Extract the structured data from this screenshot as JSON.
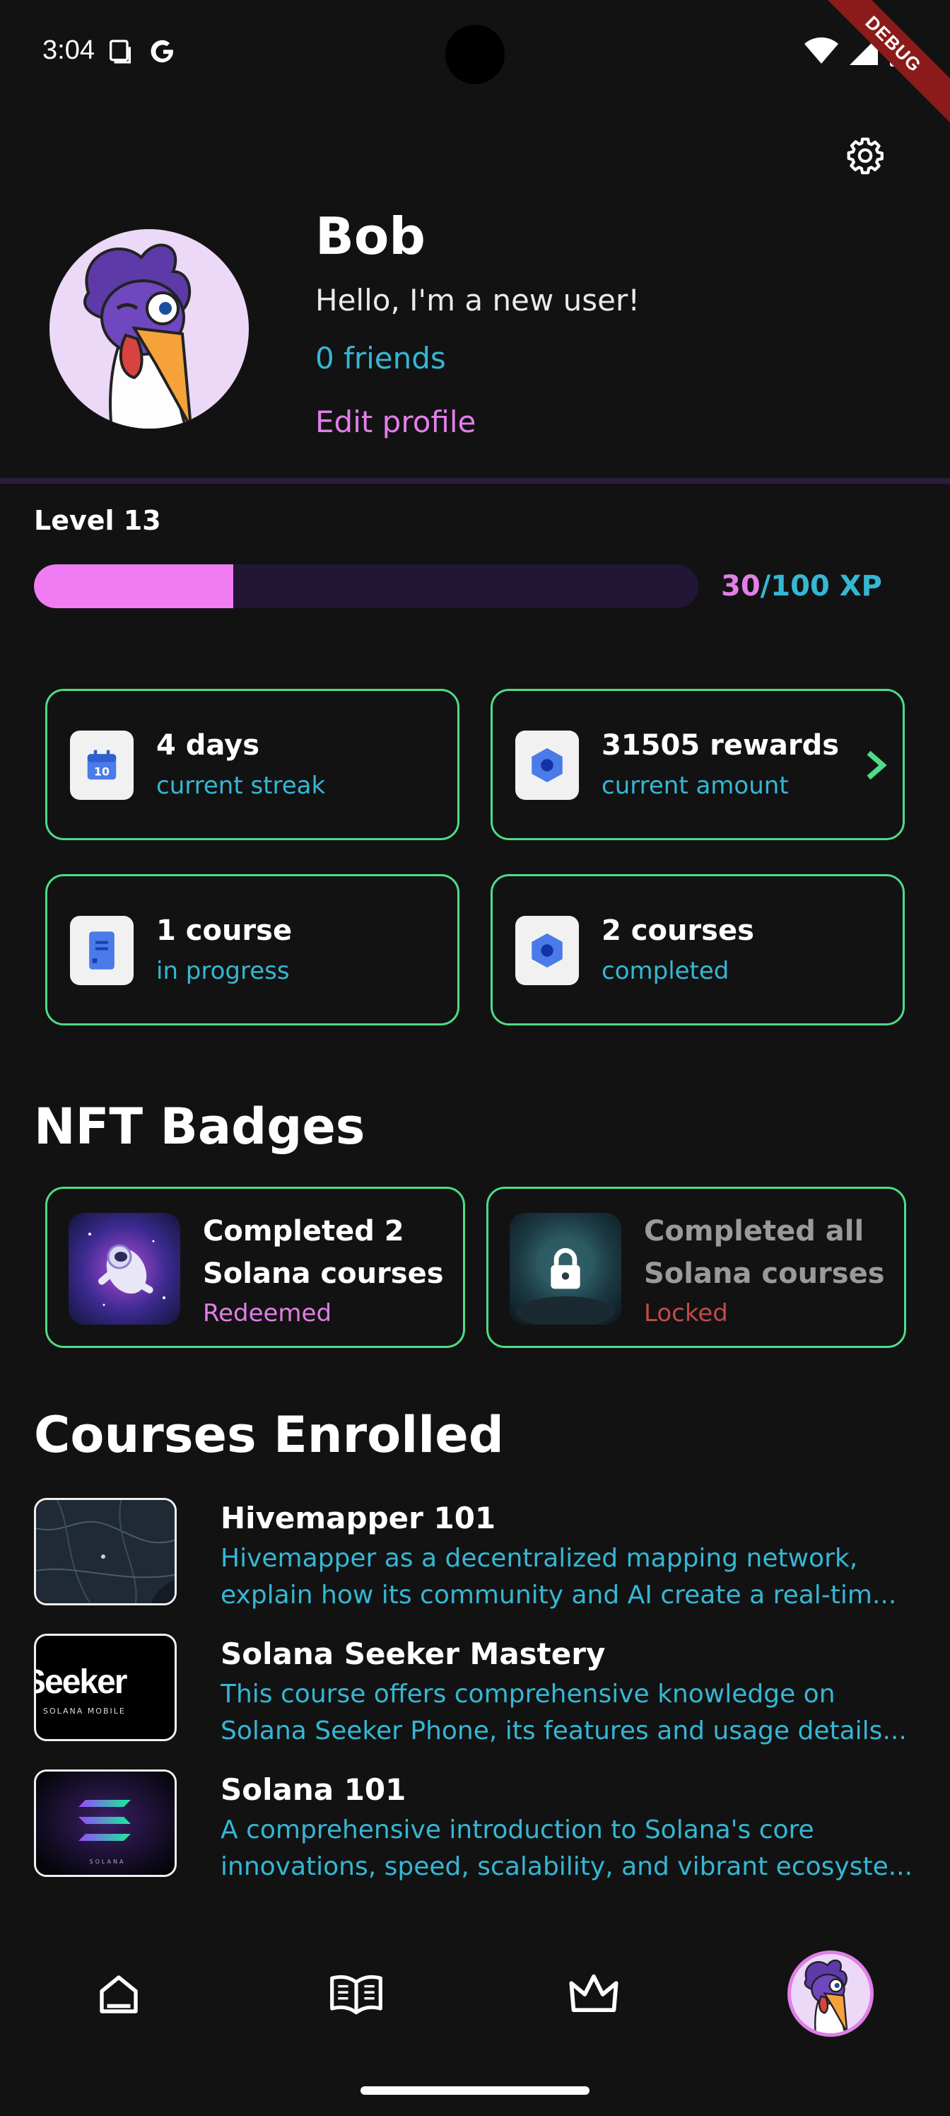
{
  "status_bar": {
    "time": "3:04",
    "ribbon": "DEBUG"
  },
  "profile": {
    "name": "Bob",
    "bio": "Hello, I'm a new user!",
    "friends": "0 friends",
    "edit_label": "Edit profile"
  },
  "level": {
    "label": "Level 13",
    "xp_current": "30",
    "xp_total": "/100 XP",
    "progress_fraction": 0.3
  },
  "stats": [
    {
      "title": "4 days",
      "sub": "current streak",
      "icon": "calendar-icon"
    },
    {
      "title": "31505 rewards",
      "sub": "current amount",
      "icon": "hexagon-icon"
    },
    {
      "title": "1 course",
      "sub": "in progress",
      "icon": "book-icon"
    },
    {
      "title": "2 courses",
      "sub": "completed",
      "icon": "hexagon-icon"
    }
  ],
  "badges_section": {
    "heading": "NFT Badges",
    "items": [
      {
        "title": "Completed 2 Solana courses",
        "status": "Redeemed",
        "status_color": "#e27ee8"
      },
      {
        "title": "Completed all Solana courses",
        "status": "Locked",
        "status_color": "#c24a4a"
      }
    ]
  },
  "courses_section": {
    "heading": "Courses Enrolled",
    "items": [
      {
        "title": "Hivemapper 101",
        "desc_line1": "Hivemapper as a decentralized mapping network,",
        "desc_line2": "explain how its community and AI create a real-tim..."
      },
      {
        "title": "Solana Seeker Mastery",
        "desc_line1": "This course offers comprehensive knowledge on",
        "desc_line2": "Solana Seeker Phone, its features and usage details...",
        "thumb_text": "Seeker",
        "thumb_subtext": "SOLANA  MOBILE"
      },
      {
        "title": "Solana 101",
        "desc_line1": "A comprehensive introduction to Solana's core",
        "desc_line2": "innovations, speed, scalability, and vibrant ecosyste...",
        "thumb_text": "SOLANA"
      }
    ]
  },
  "nav": [
    "home-icon",
    "book-open-icon",
    "crown-icon",
    "profile-avatar"
  ],
  "colors": {
    "accent_pink": "#e27ee8",
    "accent_cyan": "#35b7d4",
    "accent_green": "#4ddc87",
    "background": "#121212"
  }
}
